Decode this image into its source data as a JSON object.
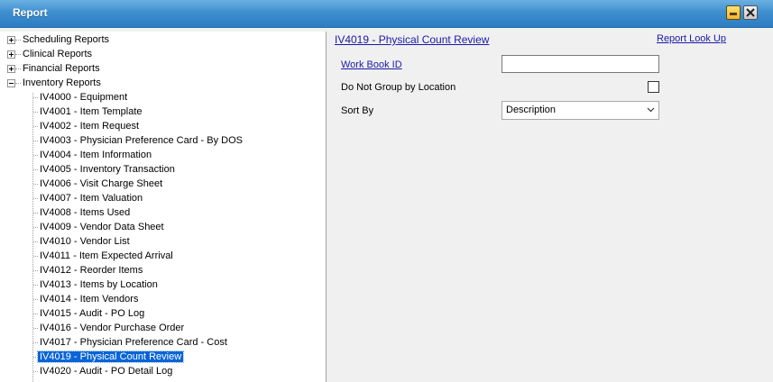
{
  "window": {
    "title": "Report"
  },
  "tree": {
    "categories": [
      {
        "label": "Scheduling Reports",
        "expanded": false
      },
      {
        "label": "Clinical Reports",
        "expanded": false
      },
      {
        "label": "Financial Reports",
        "expanded": false
      },
      {
        "label": "Inventory Reports",
        "expanded": true
      }
    ],
    "inventory_items": [
      "IV4000 - Equipment",
      "IV4001 - Item Template",
      "IV4002 - Item Request",
      "IV4003 - Physician Preference Card - By DOS",
      "IV4004 - Item Information",
      "IV4005 - Inventory Transaction",
      "IV4006 - Visit Charge Sheet",
      "IV4007 - Item Valuation",
      "IV4008 - Items Used",
      "IV4009 - Vendor Data Sheet",
      "IV4010 - Vendor List",
      "IV4011 - Item Expected Arrival",
      "IV4012 - Reorder Items",
      "IV4013 - Items by Location",
      "IV4014 - Item Vendors",
      "IV4015 - Audit - PO Log",
      "IV4016 - Vendor Purchase Order",
      "IV4017 - Physician Preference Card - Cost",
      "IV4019 - Physical Count Review",
      "IV4020 - Audit - PO Detail Log"
    ],
    "selected": "IV4019 - Physical Count Review"
  },
  "report": {
    "title": "IV4019 - Physical Count Review",
    "lookup_link": "Report Look Up",
    "workbook_label": "Work Book ID",
    "workbook_value": "",
    "group_label": "Do Not Group by Location",
    "group_checked": false,
    "sortby_label": "Sort By",
    "sortby_value": "Description"
  }
}
